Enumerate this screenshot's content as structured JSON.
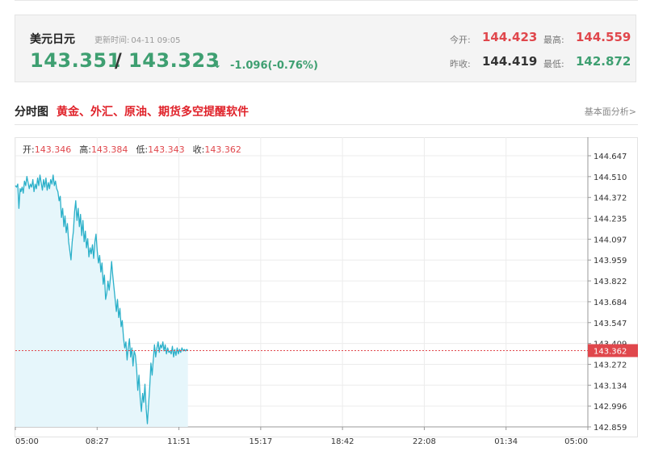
{
  "quote": {
    "name": "美元日元",
    "update_label": "更新时间:",
    "update_time": "04-11 09:05",
    "bid": "143.351",
    "slash": "/",
    "ask": "143.323",
    "arrow": "↓",
    "change": "-1.096(-0.76%)",
    "open_label": "今开:",
    "open": "144.423",
    "high_label": "最高:",
    "high": "144.559",
    "prev_close_label": "昨收:",
    "prev_close": "144.419",
    "low_label": "最低:",
    "low": "142.872"
  },
  "section": {
    "title": "分时图",
    "promo": "黄金、外汇、原油、期货多空提醒软件",
    "link": "基本面分析>"
  },
  "ohlc": {
    "open_label": "开:",
    "open": "143.346",
    "high_label": "高:",
    "high": "143.384",
    "low_label": "低:",
    "low": "143.343",
    "close_label": "收:",
    "close": "143.362"
  },
  "colors": {
    "line": "#2bb0c9",
    "fill": "#e6f6fb",
    "current": "#e0474c",
    "grid": "#ececec",
    "up": "#e0474c",
    "down": "#3e9f71"
  },
  "chart_data": {
    "type": "line",
    "x_ticks": [
      "05:00",
      "08:27",
      "11:51",
      "15:17",
      "18:42",
      "22:08",
      "01:34",
      "05:00"
    ],
    "y_ticks": [
      "144.647",
      "144.510",
      "144.372",
      "144.235",
      "144.097",
      "143.959",
      "143.822",
      "143.684",
      "143.547",
      "143.409",
      "143.272",
      "143.134",
      "142.996",
      "142.859"
    ],
    "ylim": [
      142.859,
      144.647
    ],
    "current_price": 143.362,
    "current_label": "143.362",
    "x_index_range": [
      0,
      1440
    ],
    "series": [
      {
        "x": [
          0,
          3,
          6,
          9,
          12,
          14,
          17,
          20,
          23,
          26,
          29,
          32,
          35,
          38,
          41,
          44,
          47,
          50,
          53,
          56,
          59,
          62,
          65,
          68,
          71,
          74,
          77,
          80,
          83,
          86,
          89,
          92,
          95,
          98,
          101,
          104,
          107,
          110,
          113,
          116,
          119,
          122,
          125,
          128,
          131,
          134,
          137,
          140,
          143,
          146,
          149,
          152,
          155,
          158,
          161,
          164,
          167,
          170,
          173,
          176,
          179,
          182,
          185,
          188,
          191,
          194,
          197,
          200,
          203,
          206,
          209,
          212,
          215,
          218,
          221,
          224,
          227,
          230,
          233,
          236,
          239,
          242,
          245,
          248,
          251,
          254,
          257,
          260,
          263,
          266,
          269,
          272,
          275,
          278,
          281,
          284,
          287,
          290,
          293,
          296,
          299,
          302,
          305,
          308,
          311,
          314,
          317,
          320,
          323,
          326,
          329,
          332,
          335,
          338,
          341,
          344,
          347,
          350,
          353,
          356,
          359,
          362,
          365,
          368,
          371,
          374,
          377,
          380,
          383,
          386,
          389,
          392,
          395,
          398,
          401,
          404,
          407,
          410,
          413,
          416,
          419,
          422,
          425,
          428,
          431,
          434
        ],
        "values": [
          144.45,
          144.44,
          144.46,
          144.3,
          144.43,
          144.41,
          144.44,
          144.4,
          144.48,
          144.45,
          144.51,
          144.47,
          144.43,
          144.46,
          144.44,
          144.49,
          144.41,
          144.46,
          144.43,
          144.5,
          144.45,
          144.52,
          144.47,
          144.42,
          144.49,
          144.44,
          144.5,
          144.42,
          144.47,
          144.43,
          144.49,
          144.46,
          144.52,
          144.45,
          144.48,
          144.43,
          144.41,
          144.35,
          144.38,
          144.24,
          144.3,
          144.18,
          144.25,
          144.14,
          144.2,
          144.08,
          144.02,
          143.96,
          144.08,
          144.15,
          144.28,
          144.35,
          144.22,
          144.3,
          144.18,
          144.26,
          144.12,
          144.22,
          144.08,
          144.15,
          144.04,
          144.1,
          143.98,
          144.04,
          144.0,
          144.06,
          143.97,
          144.08,
          144.13,
          144.02,
          143.94,
          143.99,
          143.88,
          143.94,
          143.8,
          143.86,
          143.7,
          143.74,
          143.82,
          143.76,
          143.84,
          143.95,
          143.86,
          143.78,
          143.7,
          143.62,
          143.7,
          143.58,
          143.64,
          143.52,
          143.56,
          143.45,
          143.38,
          143.42,
          143.3,
          143.38,
          143.44,
          143.32,
          143.38,
          143.26,
          143.36,
          143.33,
          143.24,
          143.1,
          143.2,
          143.05,
          142.96,
          143.08,
          143.02,
          143.14,
          142.98,
          142.88,
          143.0,
          143.12,
          143.28,
          143.2,
          143.3,
          143.4,
          143.32,
          143.38,
          143.42,
          143.35,
          143.4,
          143.38,
          143.42,
          143.36,
          143.4,
          143.34,
          143.38,
          143.35,
          143.36,
          143.34,
          143.39,
          143.32,
          143.37,
          143.33,
          143.38,
          143.34,
          143.37,
          143.35,
          143.38,
          143.36,
          143.37,
          143.36,
          143.37,
          143.362
        ]
      }
    ]
  }
}
